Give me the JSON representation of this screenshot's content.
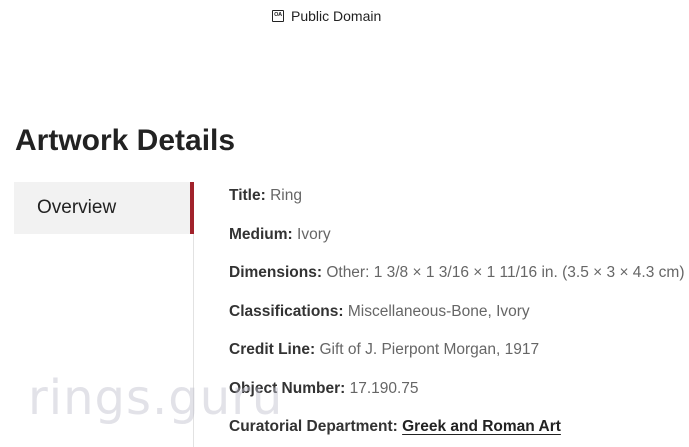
{
  "license": {
    "icon": "open-access-icon",
    "icon_text": "OA",
    "label": "Public Domain"
  },
  "section": {
    "title": "Artwork Details"
  },
  "tabs": [
    {
      "label": "Overview",
      "active": true
    }
  ],
  "details": [
    {
      "label": "Title:",
      "value": "Ring"
    },
    {
      "label": "Medium:",
      "value": "Ivory"
    },
    {
      "label": "Dimensions:",
      "value": "Other: 1 3/8 × 1 3/16 × 1 11/16 in. (3.5 × 3 × 4.3 cm)"
    },
    {
      "label": "Classifications:",
      "value": "Miscellaneous-Bone, Ivory"
    },
    {
      "label": "Credit Line:",
      "value": "Gift of J. Pierpont Morgan, 1917"
    },
    {
      "label": "Object Number:",
      "value": "17.190.75"
    },
    {
      "label": "Curatorial Department:",
      "link": "Greek and Roman Art"
    }
  ],
  "watermark": "rings.guru",
  "colors": {
    "accent": "#a1222b",
    "tab_bg": "#f2f2f2",
    "label": "#333333",
    "value": "#666666"
  }
}
